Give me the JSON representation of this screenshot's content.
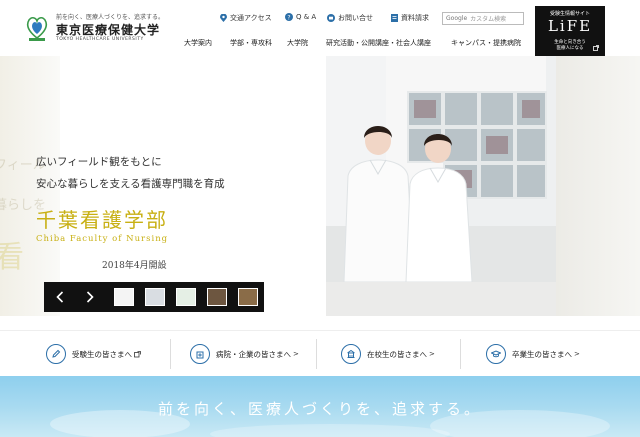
{
  "header": {
    "logo": {
      "tagline": "前を向く、医療人づくりを、追求する。",
      "name_ja": "東京医療保健大学",
      "name_en": "TOKYO HEALTHCARE UNIVERSITY"
    },
    "utility": {
      "access": "交通アクセス",
      "qa": "Q & A",
      "contact": "お問い合せ",
      "request": "資料請求"
    },
    "search": {
      "brand": "Google",
      "placeholder": "カスタム検索"
    },
    "nav": [
      "大学案内",
      "学部・専攻科",
      "大学院",
      "研究活動・公開講座・社会人講座",
      "キャンパス・提携病院"
    ],
    "life_banner": {
      "top": "受験生情報サイト",
      "logo": "LiFE",
      "sub1": "生命と向き合う",
      "sub2": "医療人になる"
    }
  },
  "hero": {
    "line1": "広いフィールド観をもとに",
    "line2": "安心な暮らしを支える看護専門職を育成",
    "title": "千葉看護学部",
    "title_en": "Chiba Faculty of Nursing",
    "date": "2018年4月開設",
    "ghost": [
      "フィール",
      "暮らしを",
      "看"
    ]
  },
  "audience": [
    {
      "label": "受験生の皆さまへ",
      "icon": "pencil-icon"
    },
    {
      "label": "病院・企業の皆さまへ",
      "icon": "hospital-icon"
    },
    {
      "label": "在校生の皆さまへ",
      "icon": "building-icon"
    },
    {
      "label": "卒業生の皆さまへ",
      "icon": "graduation-cap-icon"
    }
  ],
  "banner": {
    "text": "前を向く、医療人づくりを、追求する。"
  },
  "colors": {
    "accent_gold": "#c8b014",
    "icon_blue": "#2c6fa8",
    "banner_sky": "#8ecfee"
  }
}
